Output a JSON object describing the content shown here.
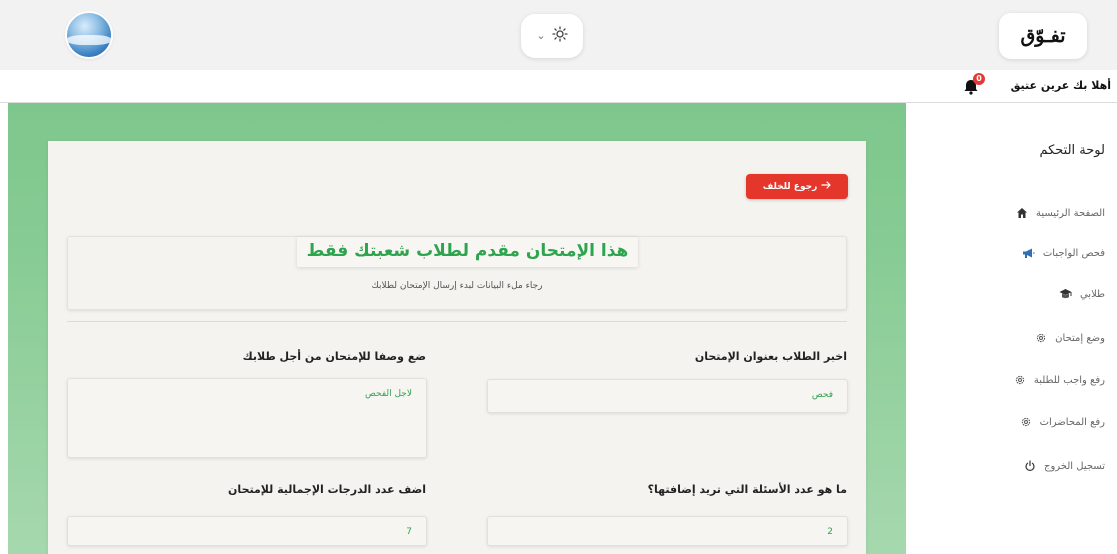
{
  "app": {
    "logo_text": "تفـوّق",
    "theme_chevron": "⌄",
    "theme_icon": "sun-icon"
  },
  "subheader": {
    "greeting": "أهلا بك عرين عتيق",
    "notifications_count": "0"
  },
  "sidebar": {
    "title": "لوحة التحكم",
    "items": [
      {
        "label": "الصفحة الرئيسية",
        "icon": "home-icon"
      },
      {
        "label": "فحص الواجبات",
        "icon": "megaphone-icon"
      },
      {
        "label": "طلابي",
        "icon": "graduation-cap-icon"
      },
      {
        "label": "وضع إمتحان",
        "icon": "gear-icon"
      },
      {
        "label": "رفع واجب للطلبة",
        "icon": "gear-icon"
      },
      {
        "label": "رفع المحاضرات",
        "icon": "gear-icon"
      },
      {
        "label": "تسجيل الخروج",
        "icon": "power-icon"
      }
    ]
  },
  "main": {
    "back_button": "رجوع للخلف",
    "notice_title": "هذا الإمتحان مقدم لطلاب شعبتك فقط",
    "notice_subtitle": "رجاء ملء البيانات لبدء إرسال الإمتحان لطلابك",
    "fields": {
      "exam_title_label": "اخبر الطلاب بعنوان الإمتحان",
      "exam_title_value": "فحص",
      "description_label": "ضع وصفا للإمتحان من أجل طلابك",
      "description_value": "لاجل الفحص",
      "questions_label": "ما هو عدد الأسئلة التي تريد إضافتها؟",
      "questions_value": "2",
      "total_grade_label": "اضف عدد الدرجات الإجمالية للإمتحان",
      "total_grade_value": "7"
    }
  },
  "colors": {
    "accent_green": "#2ea44f",
    "background_green": "#7ec78c",
    "danger_red": "#e5362c"
  }
}
